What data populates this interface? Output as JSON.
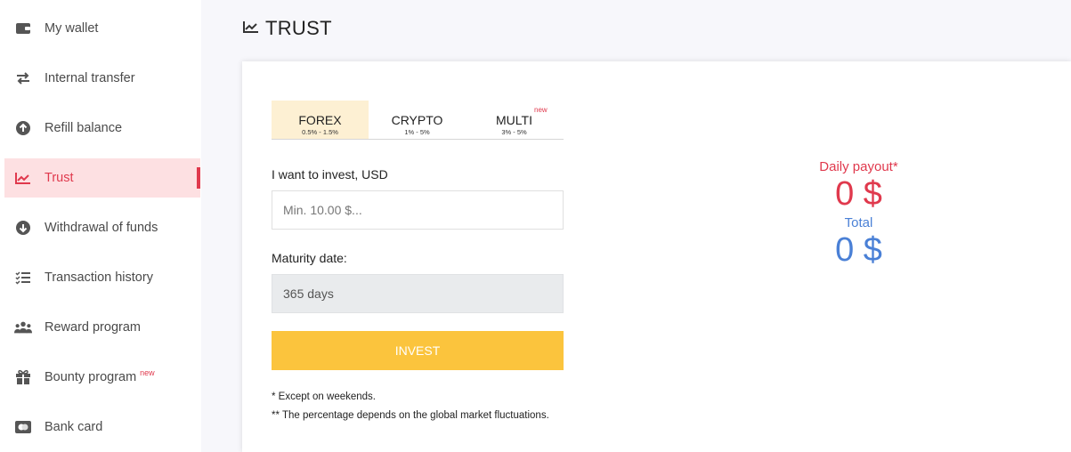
{
  "sidebar": {
    "items": [
      {
        "label": "My wallet",
        "icon": "wallet-icon"
      },
      {
        "label": "Internal transfer",
        "icon": "transfer-arrows-icon"
      },
      {
        "label": "Refill balance",
        "icon": "arrow-up-circle-icon"
      },
      {
        "label": "Trust",
        "icon": "chart-line-icon",
        "active": true
      },
      {
        "label": "Withdrawal of funds",
        "icon": "arrow-down-circle-icon"
      },
      {
        "label": "Transaction history",
        "icon": "list-check-icon"
      },
      {
        "label": "Reward program",
        "icon": "users-icon"
      },
      {
        "label": "Bounty program",
        "icon": "gift-icon",
        "badge": "new"
      },
      {
        "label": "Bank card",
        "icon": "card-icon"
      }
    ]
  },
  "header": {
    "title": "TRUST"
  },
  "tabs": [
    {
      "name": "FOREX",
      "range": "0.5% - 1.5%",
      "active": true
    },
    {
      "name": "CRYPTO",
      "range": "1% - 5%"
    },
    {
      "name": "MULTI",
      "range": "3% - 5%",
      "badge": "new"
    }
  ],
  "form": {
    "invest_label": "I want to invest, USD",
    "invest_placeholder": "Min. 10.00 $...",
    "maturity_label": "Maturity date:",
    "maturity_value": "365 days",
    "invest_button": "INVEST"
  },
  "notes": {
    "weekends": "* Except on weekends.",
    "percentage": "** The percentage depends on the global market fluctuations."
  },
  "summary": {
    "daily_label": "Daily payout*",
    "daily_value": "0 $",
    "total_label": "Total",
    "total_value": "0 $"
  },
  "colors": {
    "accent_red": "#e0394d",
    "accent_yellow": "#fbc43d",
    "accent_blue": "#4a80d6"
  }
}
